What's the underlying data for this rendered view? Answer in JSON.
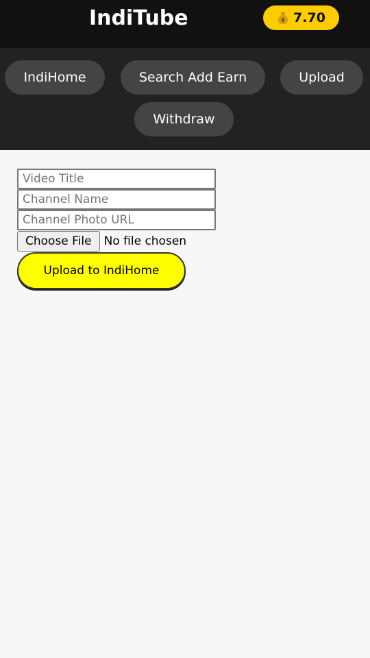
{
  "header": {
    "title": "IndiTube",
    "balance": "7.70",
    "balance_icon": "money-bag-icon"
  },
  "nav": {
    "items": [
      {
        "label": "IndiHome"
      },
      {
        "label": "Search Add Earn"
      },
      {
        "label": "Upload"
      },
      {
        "label": "Withdraw"
      }
    ]
  },
  "upload_form": {
    "video_title_placeholder": "Video Title",
    "channel_name_placeholder": "Channel Name",
    "channel_photo_placeholder": "Channel Photo URL",
    "choose_file_label": "Choose File",
    "file_status": "No file chosen",
    "submit_label": "Upload to IndiHome"
  },
  "colors": {
    "header_bg": "#111111",
    "nav_bg": "#222222",
    "nav_button": "#444444",
    "balance_badge": "#ffcc00",
    "upload_button": "#ffff00"
  }
}
